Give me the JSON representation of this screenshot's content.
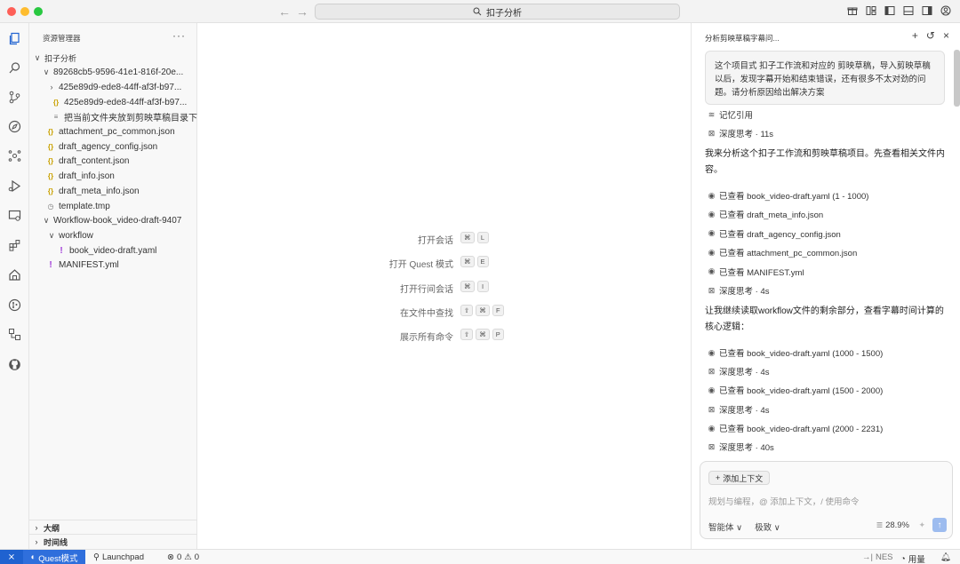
{
  "titlebar": {
    "search_text": "扣子分析"
  },
  "sidebar": {
    "header": "资源管理器",
    "more": "···",
    "tree": [
      {
        "label": "扣子分析",
        "indent": 0,
        "chev": "∨",
        "icon": "",
        "bold": true
      },
      {
        "label": "89268cb5-9596-41e1-816f-20e...",
        "indent": 1,
        "chev": "∨",
        "icon": ""
      },
      {
        "label": "425e89d9-ede8-44ff-af3f-b97...",
        "indent": 2,
        "chev": "›",
        "icon": ""
      },
      {
        "label": "425e89d9-ede8-44ff-af3f-b97...",
        "indent": 2,
        "chev": "",
        "icon": "{}"
      },
      {
        "label": "把当前文件夹放到剪映草稿目录下",
        "indent": 2,
        "chev": "",
        "icon": "≡"
      },
      {
        "label": "attachment_pc_common.json",
        "indent": 1,
        "chev": "",
        "icon": "{}"
      },
      {
        "label": "draft_agency_config.json",
        "indent": 1,
        "chev": "",
        "icon": "{}"
      },
      {
        "label": "draft_content.json",
        "indent": 1,
        "chev": "",
        "icon": "{}"
      },
      {
        "label": "draft_info.json",
        "indent": 1,
        "chev": "",
        "icon": "{}"
      },
      {
        "label": "draft_meta_info.json",
        "indent": 1,
        "chev": "",
        "icon": "{}"
      },
      {
        "label": "template.tmp",
        "indent": 1,
        "chev": "",
        "icon": "◷"
      },
      {
        "label": "Workflow-book_video-draft-9407",
        "indent": 1,
        "chev": "∨",
        "icon": ""
      },
      {
        "label": "workflow",
        "indent": 2,
        "chev": "∨",
        "icon": ""
      },
      {
        "label": "book_video-draft.yaml",
        "indent": 3,
        "chev": "",
        "icon": "!"
      },
      {
        "label": "MANIFEST.yml",
        "indent": 1,
        "chev": "",
        "icon": "!"
      }
    ],
    "outline": "大纲",
    "timeline": "时间线"
  },
  "editor": {
    "shortcuts": [
      {
        "label": "打开会话",
        "keys": [
          "⌘",
          "L"
        ]
      },
      {
        "label": "打开 Quest 模式",
        "keys": [
          "⌘",
          "E"
        ]
      },
      {
        "label": "打开行间会话",
        "keys": [
          "⌘",
          "I"
        ]
      },
      {
        "label": "在文件中查找",
        "keys": [
          "⇧",
          "⌘",
          "F"
        ]
      },
      {
        "label": "展示所有命令",
        "keys": [
          "⇧",
          "⌘",
          "P"
        ]
      }
    ]
  },
  "chat": {
    "title": "分析剪映草稿字幕问...",
    "user_message": "这个项目式 扣子工作流和对应的 剪映草稿，导入剪映草稿以后，发现字幕开始和结束错误，还有很多不太对劲的问题。请分析原因给出解决方案",
    "memory": "记忆引用",
    "think1": "深度思考 · 11s",
    "para1": "我来分析这个扣子工作流和剪映草稿项目。先查看相关文件内容。",
    "views1": [
      "已查看 book_video-draft.yaml (1 - 1000)",
      "已查看 draft_meta_info.json",
      "已查看 draft_agency_config.json",
      "已查看 attachment_pc_common.json",
      "已查看 MANIFEST.yml"
    ],
    "think2": "深度思考 · 4s",
    "para2": "让我继续读取workflow文件的剩余部分，查看字幕时间计算的核心逻辑：",
    "view_a": "已查看 book_video-draft.yaml (1000 - 1500)",
    "think3": "深度思考 · 4s",
    "view_b": "已查看 book_video-draft.yaml (1500 - 2000)",
    "think4": "深度思考 · 4s",
    "view_c": "已查看 book_video-draft.yaml (2000 - 2231)",
    "think5": "深度思考 · 40s",
    "add_context": "添加上下文",
    "input_placeholder": "规划与编程，@ 添加上下文，/ 使用命令",
    "mode": "智能体",
    "model": "极致",
    "context_pct": "28.9%"
  },
  "statusbar": {
    "quest": "Quest模式",
    "launchpad": "Launchpad",
    "errors": "0",
    "warnings": "0",
    "nes": "NES",
    "usage": "用量"
  }
}
